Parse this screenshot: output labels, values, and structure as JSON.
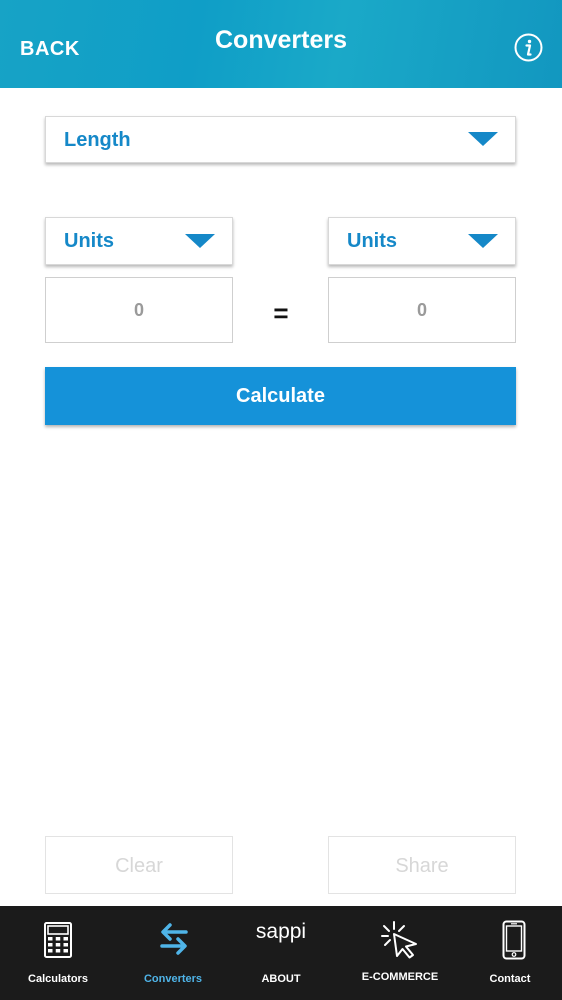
{
  "header": {
    "back_label": "BACK",
    "title": "Converters",
    "info_icon": "info-icon"
  },
  "converter": {
    "category": "Length",
    "from_unit": "Units",
    "to_unit": "Units",
    "from_value": "0",
    "to_value": "0",
    "equals": "=",
    "calculate_label": "Calculate"
  },
  "actions": {
    "clear_label": "Clear",
    "share_label": "Share"
  },
  "tabbar": {
    "items": [
      {
        "label": "Calculators",
        "icon": "calculator-icon",
        "active": false
      },
      {
        "label": "Converters",
        "icon": "swap-arrows-icon",
        "active": true
      },
      {
        "label": "ABOUT",
        "icon": "sappi-logo",
        "logo_text": "sappi",
        "active": false
      },
      {
        "label": "E-COMMERCE",
        "icon": "cursor-click-icon",
        "active": false
      },
      {
        "label": "Contact",
        "icon": "phone-icon",
        "active": false
      }
    ]
  },
  "colors": {
    "header": "#17a3c6",
    "accent": "#1588c8",
    "button": "#1592d9",
    "tabbar": "#1b1b1b",
    "active_tab": "#4fb4e8"
  }
}
